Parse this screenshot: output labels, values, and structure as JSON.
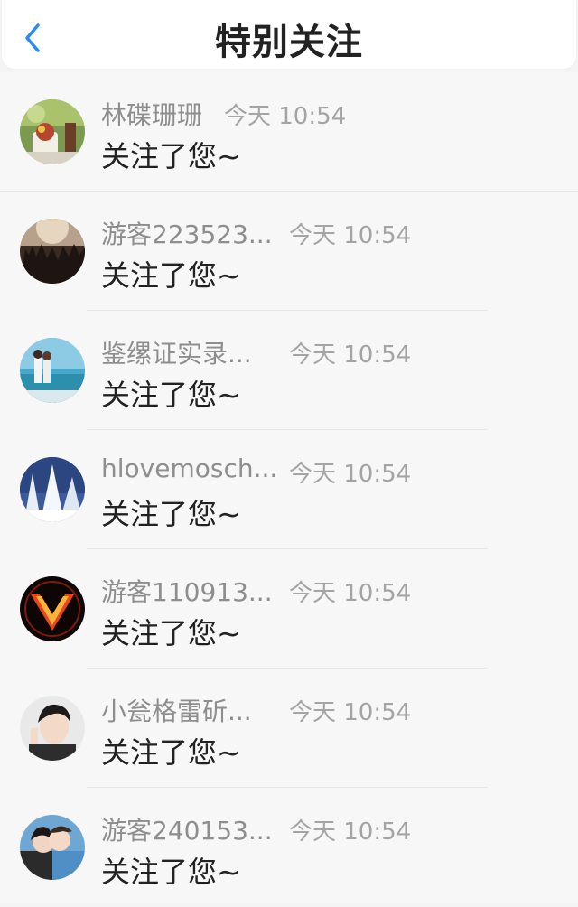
{
  "header": {
    "title": "特别关注"
  },
  "icons": {
    "back": "chevron-left-icon"
  },
  "colors": {
    "accent": "#2a8cf0"
  },
  "items": [
    {
      "name": "林碟珊珊",
      "time": "今天 10:54",
      "message": "关注了您~"
    },
    {
      "name": "游客223523...",
      "time": "今天 10:54",
      "message": "关注了您~"
    },
    {
      "name": "鉴缧证实录...",
      "time": "今天 10:54",
      "message": "关注了您~"
    },
    {
      "name": "hlovemosch...",
      "time": "今天 10:54",
      "message": "关注了您~"
    },
    {
      "name": "游客110913...",
      "time": "今天 10:54",
      "message": "关注了您~"
    },
    {
      "name": "小瓮格雷斫...",
      "time": "今天 10:54",
      "message": "关注了您~"
    },
    {
      "name": "游客240153...",
      "time": "今天 10:54",
      "message": "关注了您~"
    }
  ]
}
